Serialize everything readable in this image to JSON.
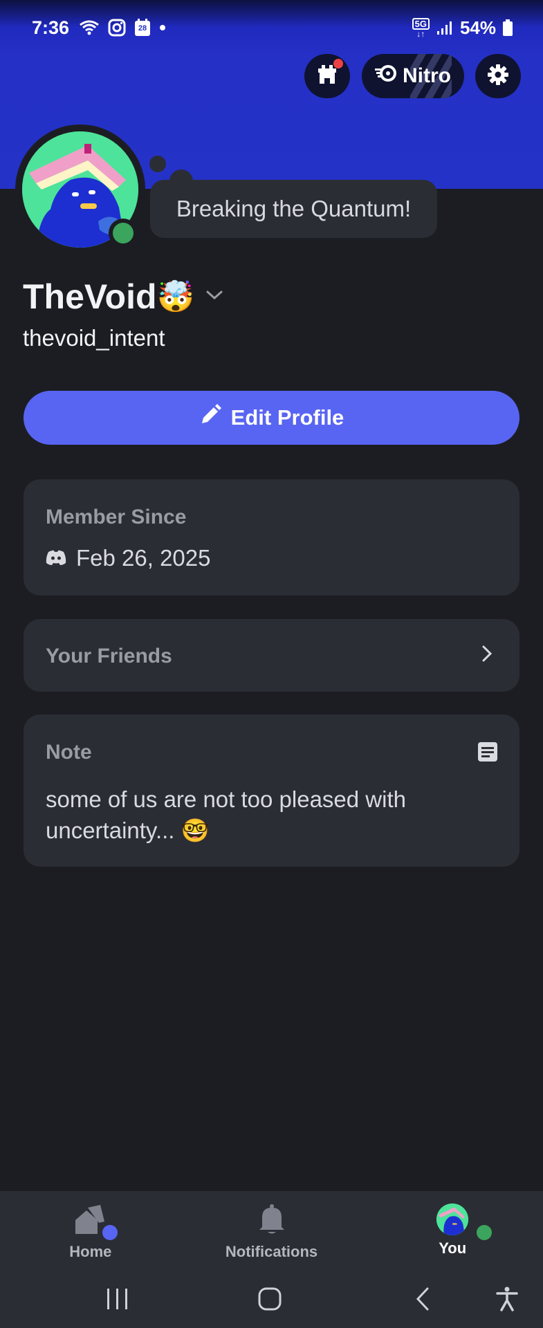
{
  "status_bar": {
    "time": "7:36",
    "calendar_day": "28",
    "network": "5G",
    "battery": "54%"
  },
  "header": {
    "nitro_label": "Nitro",
    "icons": [
      "shop-icon",
      "nitro-icon",
      "gear-icon"
    ]
  },
  "profile": {
    "custom_status": "Breaking the Quantum!",
    "display_name": "TheVoid",
    "display_name_emoji": "🤯",
    "username": "thevoid_intent",
    "online_status_color": "#3ba55d"
  },
  "actions": {
    "edit_profile_label": "Edit Profile"
  },
  "member_since": {
    "label": "Member Since",
    "date": "Feb 26, 2025"
  },
  "friends": {
    "label": "Your Friends"
  },
  "note": {
    "label": "Note",
    "text": "some of us are not too pleased with uncertainty... 🤓"
  },
  "bottom_nav": {
    "items": [
      {
        "label": "Home",
        "icon": "home-icon",
        "active": false
      },
      {
        "label": "Notifications",
        "icon": "bell-icon",
        "active": false
      },
      {
        "label": "You",
        "icon": "avatar",
        "active": true
      }
    ]
  },
  "colors": {
    "banner": "#2432c8",
    "accent": "#5865f2",
    "background": "#1c1d22",
    "card": "#2b2d35",
    "online": "#3ba55d"
  }
}
